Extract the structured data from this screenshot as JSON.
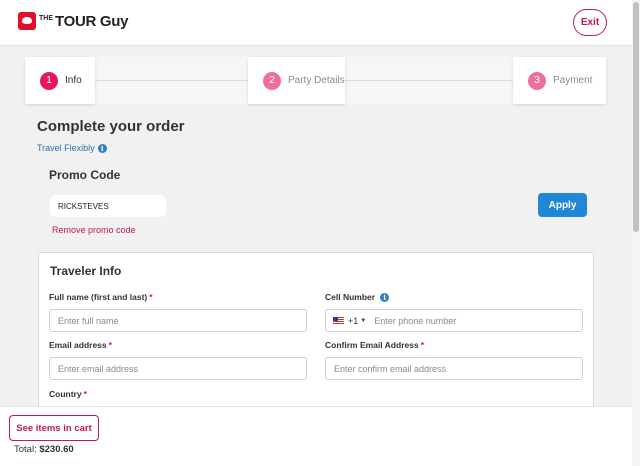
{
  "header": {
    "logo_the": "THE",
    "logo_name": "TOUR Guy",
    "exit_label": "Exit"
  },
  "steps": [
    {
      "number": "1",
      "label": "Info",
      "active": true
    },
    {
      "number": "2",
      "label": "Party Details",
      "active": false
    },
    {
      "number": "3",
      "label": "Payment",
      "active": false
    }
  ],
  "colors": {
    "brand": "#c2185b",
    "step_active": "#e8175d",
    "step_inactive": "#ee6f99",
    "primary_button": "#1f87d6",
    "link": "#2a6fb0"
  },
  "main": {
    "title": "Complete your order",
    "travel_flexibly": "Travel Flexibly",
    "info_icon": "i"
  },
  "promo": {
    "title": "Promo Code",
    "value": "RICKSTEVES",
    "apply_label": "Apply",
    "remove_label": "Remove promo code"
  },
  "traveler": {
    "title": "Traveler Info",
    "full_name_label": "Full name (first and last)",
    "full_name_placeholder": "Enter full name",
    "cell_label": "Cell Number",
    "country_code": "+1",
    "phone_placeholder": "Enter phone number",
    "email_label": "Email address",
    "email_placeholder": "Enter email address",
    "confirm_email_label": "Confirm Email Address",
    "confirm_email_placeholder": "Enter confirm email address",
    "country_label": "Country",
    "required_mark": "*"
  },
  "footer": {
    "cart_button": "See items in cart",
    "total_label": "Total:",
    "total_value": "$230.60"
  }
}
